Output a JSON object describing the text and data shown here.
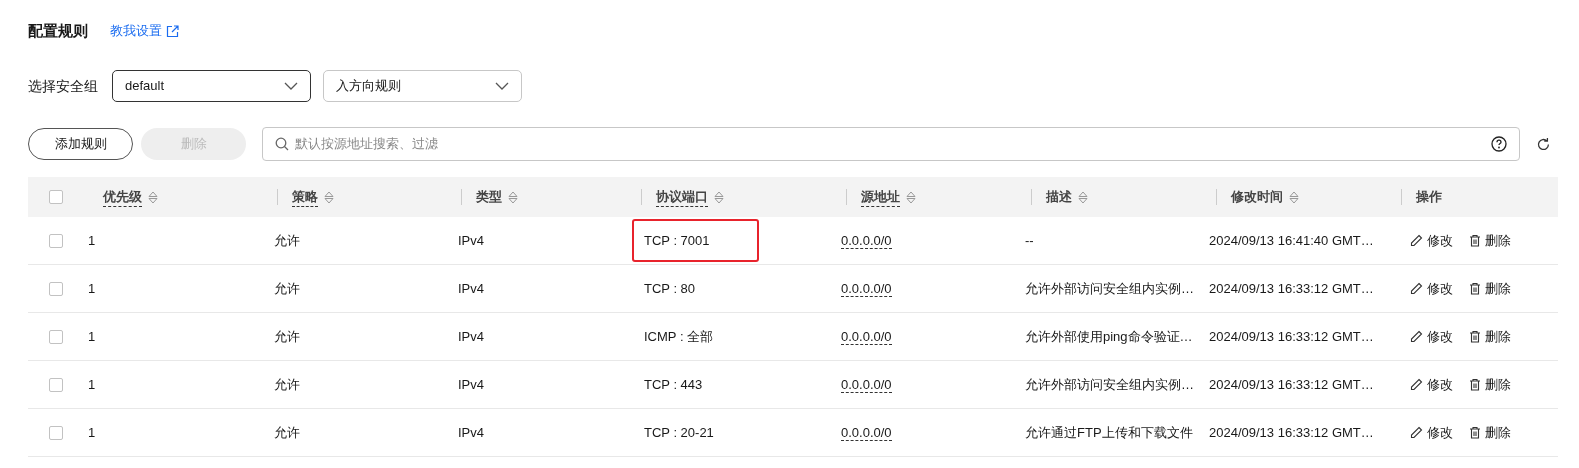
{
  "title": "配置规则",
  "help_link": "教我设置",
  "group_label": "选择安全组",
  "selects": [
    {
      "value": "default",
      "focused": true
    },
    {
      "value": "入方向规则",
      "focused": false
    }
  ],
  "buttons": [
    {
      "label": "添加规则",
      "disabled": false
    },
    {
      "label": "删除",
      "disabled": true
    }
  ],
  "search": {
    "placeholder": "默认按源地址搜索、过滤"
  },
  "table": {
    "select_all": {
      "checked": false
    },
    "columns": [
      {
        "label": "优先级",
        "sortable": true,
        "dotted": true
      },
      {
        "label": "策略",
        "sortable": true,
        "dotted": true
      },
      {
        "label": "类型",
        "sortable": true,
        "dotted": false
      },
      {
        "label": "协议端口",
        "sortable": true,
        "dotted": true
      },
      {
        "label": "源地址",
        "sortable": true,
        "dotted": true
      },
      {
        "label": "描述",
        "sortable": true,
        "dotted": false
      },
      {
        "label": "修改时间",
        "sortable": true,
        "dotted": false
      },
      {
        "label": "操作",
        "sortable": false,
        "dotted": false
      }
    ],
    "rows": [
      {
        "checked": false,
        "priority": "1",
        "policy": "允许",
        "type": "IPv4",
        "port": "TCP : 7001",
        "highlighted": true,
        "source": "0.0.0.0/0",
        "description": "--",
        "modified": "2024/09/13 16:41:40 GMT…",
        "actions": [
          "修改",
          "删除"
        ]
      },
      {
        "checked": false,
        "priority": "1",
        "policy": "允许",
        "type": "IPv4",
        "port": "TCP : 80",
        "highlighted": false,
        "source": "0.0.0.0/0",
        "description": "允许外部访问安全组内实例…",
        "modified": "2024/09/13 16:33:12 GMT…",
        "actions": [
          "修改",
          "删除"
        ]
      },
      {
        "checked": false,
        "priority": "1",
        "policy": "允许",
        "type": "IPv4",
        "port": "ICMP : 全部",
        "highlighted": false,
        "source": "0.0.0.0/0",
        "description": "允许外部使用ping命令验证…",
        "modified": "2024/09/13 16:33:12 GMT…",
        "actions": [
          "修改",
          "删除"
        ]
      },
      {
        "checked": false,
        "priority": "1",
        "policy": "允许",
        "type": "IPv4",
        "port": "TCP : 443",
        "highlighted": false,
        "source": "0.0.0.0/0",
        "description": "允许外部访问安全组内实例…",
        "modified": "2024/09/13 16:33:12 GMT…",
        "actions": [
          "修改",
          "删除"
        ]
      },
      {
        "checked": false,
        "priority": "1",
        "policy": "允许",
        "type": "IPv4",
        "port": "TCP : 20-21",
        "highlighted": false,
        "source": "0.0.0.0/0",
        "description": "允许通过FTP上传和下载文件",
        "modified": "2024/09/13 16:33:12 GMT…",
        "actions": [
          "修改",
          "删除"
        ]
      }
    ]
  }
}
